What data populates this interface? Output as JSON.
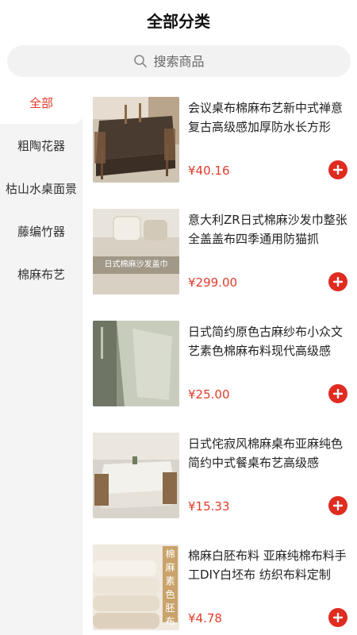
{
  "header": {
    "title": "全部分类"
  },
  "search": {
    "placeholder": "搜索商品"
  },
  "sidebar": {
    "items": [
      {
        "label": "全部",
        "active": true
      },
      {
        "label": "粗陶花器",
        "active": false
      },
      {
        "label": "枯山水桌面景",
        "active": false
      },
      {
        "label": "藤编竹器",
        "active": false
      },
      {
        "label": "棉麻布艺",
        "active": false
      }
    ]
  },
  "products": [
    {
      "name": "会议桌布棉麻布艺新中式禅意复古高级感加厚防水长方形",
      "price": "¥40.16"
    },
    {
      "name": "意大利ZR日式棉麻沙发巾整张全盖盖布四季通用防猫抓",
      "price": "¥299.00",
      "image_caption": "日式棉麻沙发盖巾"
    },
    {
      "name": "日式简约原色古麻纱布小众文艺素色棉麻布料现代高级感",
      "price": "¥25.00"
    },
    {
      "name": "日式侘寂风棉麻桌布亚麻纯色简约中式餐桌布艺高级感",
      "price": "¥15.33"
    },
    {
      "name": "棉麻白胚布料 亚麻纯棉布料手工DIY白坯布 纺织布料定制",
      "price": "¥4.78",
      "image_caption": "棉麻素色胚布"
    }
  ],
  "colors": {
    "accent": "#e13b2a",
    "sidebar_bg": "#f4f4f4",
    "search_bg": "#f2f2f2"
  },
  "icons": {
    "search": "search-icon",
    "add": "plus-circle-icon"
  }
}
